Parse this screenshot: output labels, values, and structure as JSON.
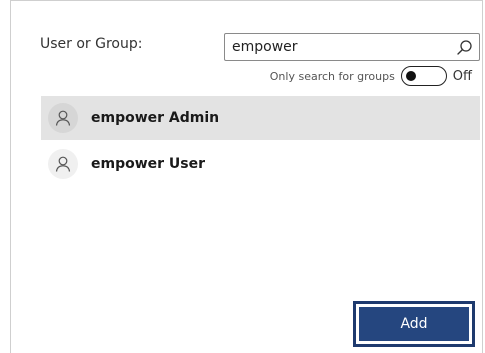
{
  "form": {
    "user_or_group_label": "User or Group:",
    "search_value": "empower",
    "toggle_caption": "Only search for groups",
    "toggle_state": "Off",
    "toggle_on": false
  },
  "results": [
    {
      "name": "empower Admin",
      "selected": true,
      "icon": "person-icon"
    },
    {
      "name": "empower User",
      "selected": false,
      "icon": "person-icon"
    }
  ],
  "actions": {
    "add_label": "Add"
  },
  "colors": {
    "primary_button": "#25467f",
    "selected_row": "#e3e3e3"
  }
}
